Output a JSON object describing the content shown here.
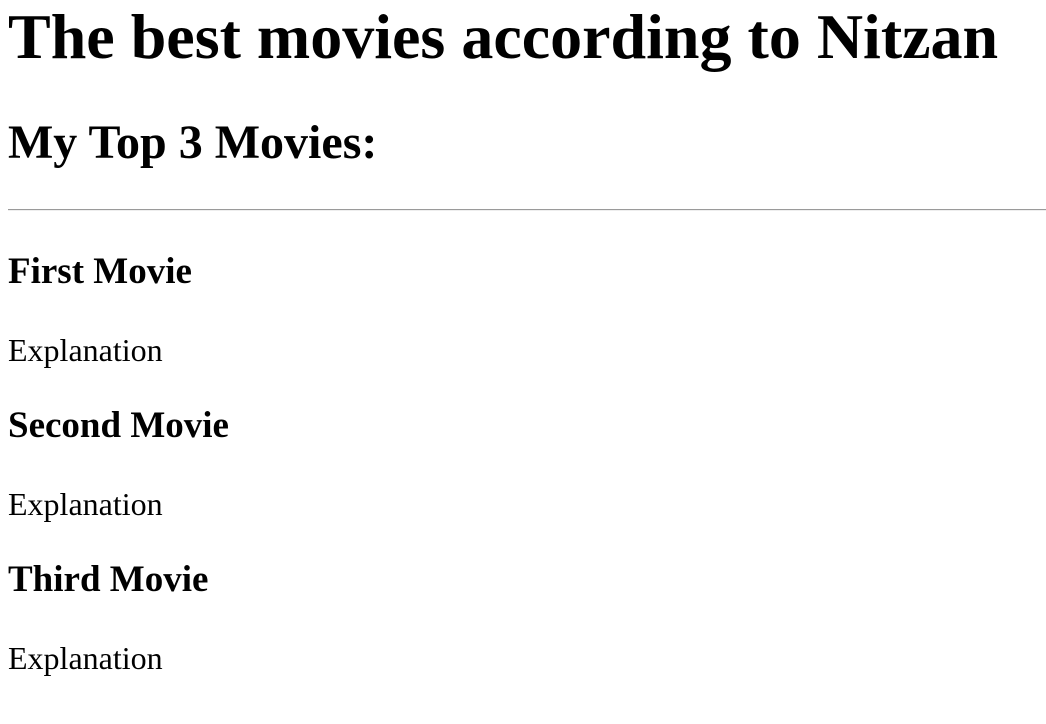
{
  "page": {
    "title": "The best movies according to Nitzan",
    "subtitle": "My Top 3 Movies:"
  },
  "movies": [
    {
      "title": "First Movie",
      "explanation": "Explanation"
    },
    {
      "title": "Second Movie",
      "explanation": "Explanation"
    },
    {
      "title": "Third Movie",
      "explanation": "Explanation"
    }
  ]
}
